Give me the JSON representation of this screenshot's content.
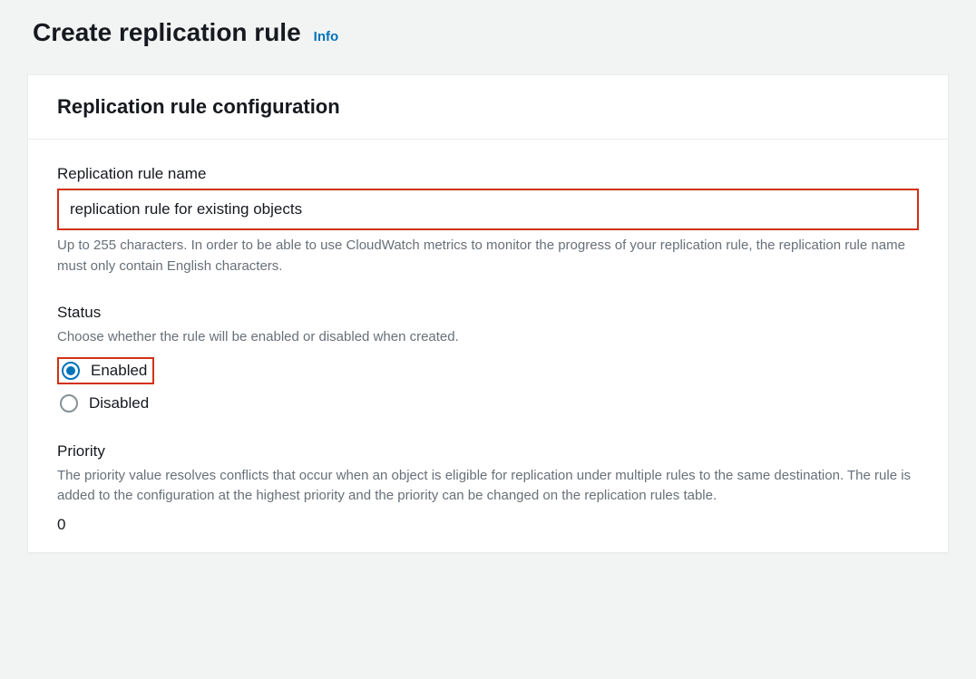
{
  "header": {
    "page_title": "Create replication rule",
    "info_label": "Info"
  },
  "panel": {
    "title": "Replication rule configuration"
  },
  "form": {
    "rule_name": {
      "label": "Replication rule name",
      "value": "replication rule for existing objects",
      "hint": "Up to 255 characters. In order to be able to use CloudWatch metrics to monitor the progress of your replication rule, the replication rule name must only contain English characters."
    },
    "status": {
      "label": "Status",
      "hint": "Choose whether the rule will be enabled or disabled when created.",
      "options": {
        "enabled": "Enabled",
        "disabled": "Disabled"
      },
      "selected": "enabled"
    },
    "priority": {
      "label": "Priority",
      "hint": "The priority value resolves conflicts that occur when an object is eligible for replication under multiple rules to the same destination. The rule is added to the configuration at the highest priority and the priority can be changed on the replication rules table.",
      "value": "0"
    }
  }
}
